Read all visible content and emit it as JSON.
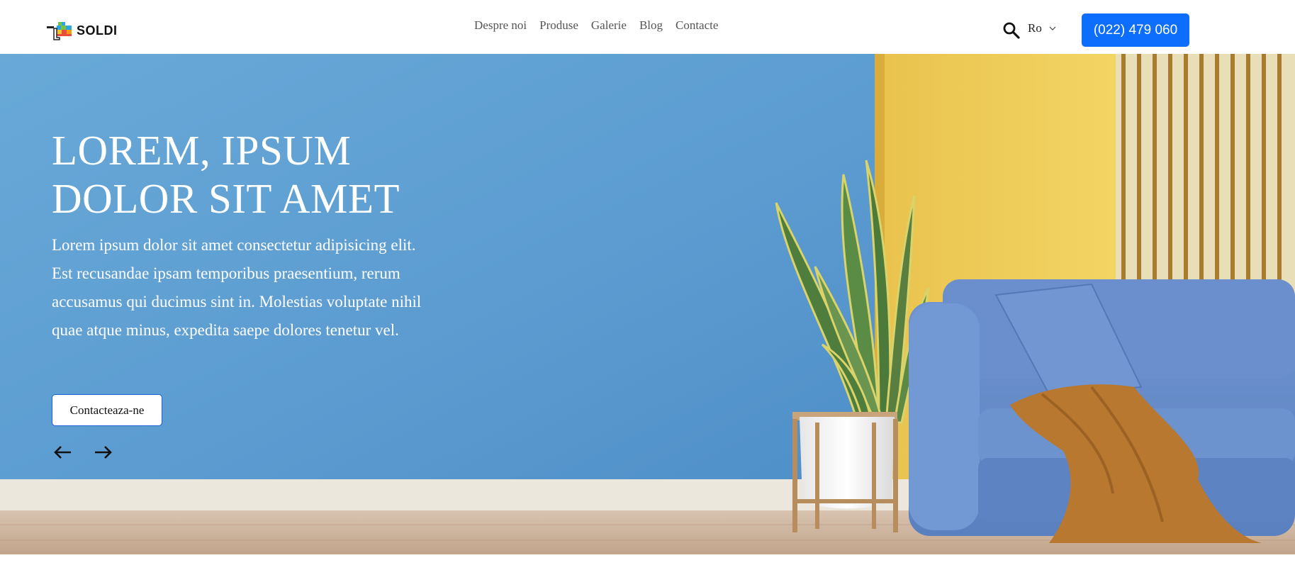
{
  "header": {
    "logo_text": "SOLDI",
    "nav": [
      {
        "label": "Despre noi"
      },
      {
        "label": "Produse"
      },
      {
        "label": "Galerie"
      },
      {
        "label": "Blog"
      },
      {
        "label": "Contacte"
      }
    ],
    "search_icon": "search-icon",
    "language": "Ro",
    "phone_label": "(022) 479 060"
  },
  "hero": {
    "title": "LOREM, IPSUM DOLOR SIT AMET",
    "text": "Lorem ipsum dolor sit amet consectetur adipisicing elit. Est recusandae ipsam temporibus praesentium, rerum accusamus qui ducimus sint in. Molestias voluptate nihil quae atque minus, expedita saepe dolores tenetur vel.",
    "cta_label": "Contacteaza-ne",
    "prev_icon": "arrow-left-icon",
    "next_icon": "arrow-right-icon"
  },
  "colors": {
    "accent": "#0d6efd",
    "wall_blue": "#5b9bd0",
    "wall_yellow": "#f2cf5a"
  }
}
